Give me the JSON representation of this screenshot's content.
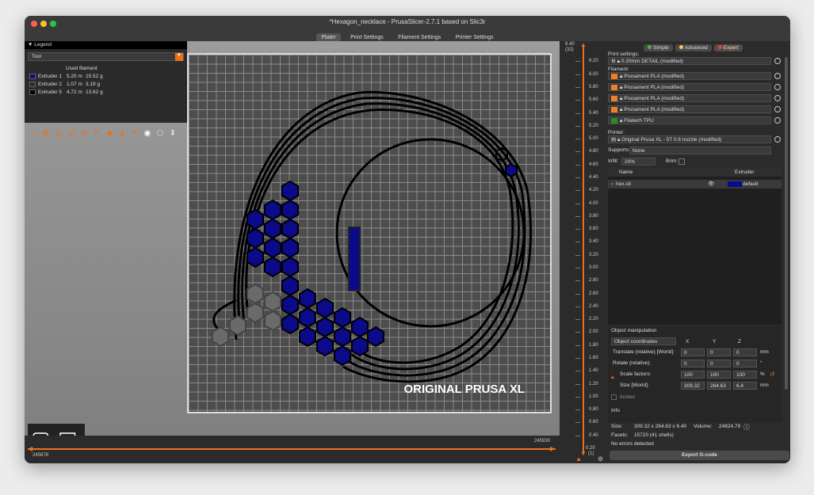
{
  "window": {
    "title": "*Hexagon_necklace - PrusaSlicer-2.7.1 based on Slic3r"
  },
  "tabs": [
    {
      "label": "Plater"
    },
    {
      "label": "Print Settings"
    },
    {
      "label": "Filament Settings"
    },
    {
      "label": "Printer Settings"
    }
  ],
  "legend": {
    "title": "Legend",
    "view_mode": "Tool",
    "column_header": "Used filament",
    "rows": [
      {
        "name": "Extruder 1",
        "length": "5.20 m",
        "weight": "15.52 g",
        "color": "#0a0a8a"
      },
      {
        "name": "Extruder 2",
        "length": "1.07 m",
        "weight": "3.19 g",
        "color": "#2b2b2b"
      },
      {
        "name": "Extruder 5",
        "length": "4.72 m",
        "weight": "13.62 g",
        "color": "#000000"
      }
    ]
  },
  "bed": {
    "label": "ORIGINAL PRUSA XL"
  },
  "vertical_slider": {
    "top_value": "6.40",
    "top_layer": "(32)",
    "bottom_value": "0.20",
    "bottom_layer": "(1)",
    "ticks": [
      "6.20",
      "6.00",
      "5.80",
      "5.60",
      "5.40",
      "5.20",
      "5.00",
      "4.80",
      "4.60",
      "4.40",
      "4.20",
      "4.00",
      "3.80",
      "3.60",
      "3.40",
      "3.20",
      "3.00",
      "2.80",
      "2.60",
      "2.40",
      "2.20",
      "2.00",
      "1.80",
      "1.60",
      "1.40",
      "1.20",
      "1.00",
      "0.80",
      "0.60",
      "0.40"
    ]
  },
  "horizontal_slider": {
    "left_value": "245678",
    "right_value": "245930"
  },
  "mode": {
    "simple": "Simple",
    "advanced": "Advanced",
    "expert": "Expert"
  },
  "print_settings": {
    "label": "Print settings:",
    "value": "0.20mm DETAIL (modified)"
  },
  "filament": {
    "label": "Filament:",
    "items": [
      {
        "value": "Prusament PLA (modified)",
        "color": "#f07d2a"
      },
      {
        "value": "Prusament PLA (modified)",
        "color": "#f07d2a"
      },
      {
        "value": "Prusament PLA (modified)",
        "color": "#f07d2a"
      },
      {
        "value": "Prusament PLA (modified)",
        "color": "#f07d2a"
      },
      {
        "value": "Filatech TPU",
        "color": "#2c8a2c"
      }
    ]
  },
  "printer": {
    "label": "Printer:",
    "value": "Original Prusa XL - 5T 0.6 nozzle (modified)"
  },
  "supports": {
    "label": "Supports:",
    "value": "None"
  },
  "infill": {
    "label": "Infill:",
    "value": "20%"
  },
  "brim": {
    "label": "Brim:"
  },
  "object_list": {
    "col_name": "Name",
    "col_extruder": "Extruder",
    "rows": [
      {
        "name": "hex.stl",
        "extruder": "default"
      }
    ]
  },
  "object_manipulation": {
    "title": "Object manipulation",
    "coords": "Object coordinates",
    "axes": [
      "X",
      "Y",
      "Z"
    ],
    "translate_label": "Translate (relative) [World]:",
    "translate": [
      "0",
      "0",
      "0"
    ],
    "translate_unit": "mm",
    "rotate_label": "Rotate (relative):",
    "rotate": [
      "0",
      "0",
      "0"
    ],
    "rotate_unit": "°",
    "scale_label": "Scale factors:",
    "scale": [
      "100",
      "100",
      "100"
    ],
    "scale_unit": "%",
    "size_label": "Size [World]:",
    "size": [
      "309.32",
      "264.63",
      "6.4"
    ],
    "size_unit": "mm",
    "inches_label": "Inches"
  },
  "info": {
    "title": "Info",
    "size_label": "Size:",
    "size_value": "309.32 x 264.63 x 6.40",
    "volume_label": "Volume:",
    "volume_value": "24824.79",
    "facets_label": "Facets:",
    "facets_value": "15720 (41 shells)",
    "errors": "No errors detected"
  },
  "export_button": "Export G-code"
}
